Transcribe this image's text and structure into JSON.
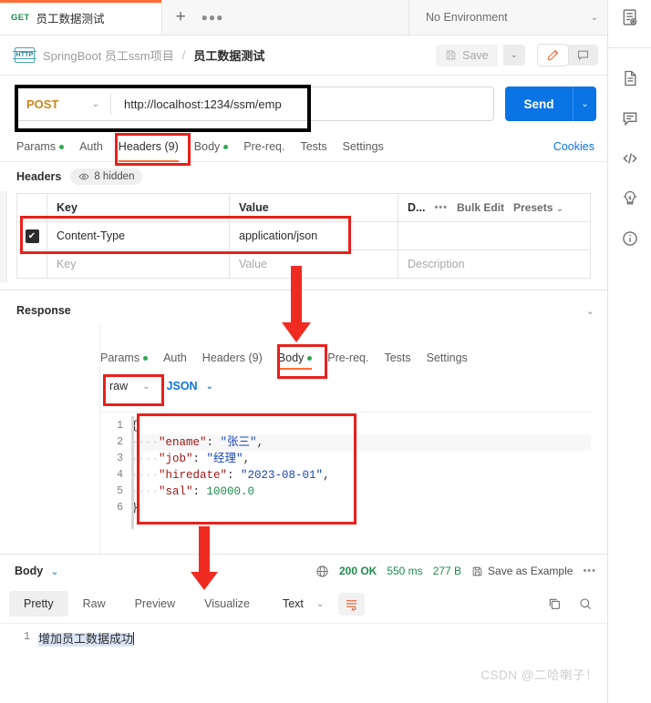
{
  "tab": {
    "method": "GET",
    "title": "员工数据测试",
    "plus_label": "+",
    "more_label": "●●●"
  },
  "environment": {
    "name": "No Environment",
    "chevron": "⌄",
    "eye_icon": "environment-quick-look-icon"
  },
  "breadcrumb": {
    "protocol_badge": "HTTP",
    "collection": "SpringBoot 员工ssm项目",
    "separator": "/",
    "request": "员工数据测试",
    "save_label": "Save",
    "save_caret": "⌄",
    "edit_icon": "pencil-icon",
    "comment_icon": "comment-icon"
  },
  "url": {
    "method": "POST",
    "method_chevron": "⌄",
    "value": "http://localhost:1234/ssm/emp",
    "send_label": "Send",
    "send_caret": "⌄"
  },
  "request_tabs": [
    {
      "label": "Params",
      "dot": true,
      "active": false
    },
    {
      "label": "Auth",
      "dot": false,
      "active": false
    },
    {
      "label": "Headers (9)",
      "dot": false,
      "active": true
    },
    {
      "label": "Body",
      "dot": true,
      "active": false
    },
    {
      "label": "Pre-req.",
      "dot": false,
      "active": false
    },
    {
      "label": "Tests",
      "dot": false,
      "active": false
    },
    {
      "label": "Settings",
      "dot": false,
      "active": false
    }
  ],
  "cookies_link": "Cookies",
  "headers": {
    "title": "Headers",
    "hidden_badge": "8 hidden",
    "eye_icon": "eye-icon",
    "columns": {
      "key": "Key",
      "value": "Value",
      "description": "D..."
    },
    "toolbar": {
      "more": "•••",
      "bulk_edit": "Bulk Edit",
      "presets": "Presets",
      "presets_chevron": "⌄"
    },
    "rows": [
      {
        "checked": true,
        "key": "Content-Type",
        "value": "application/json",
        "description": ""
      }
    ],
    "placeholder_row": {
      "key": "Key",
      "value": "Value",
      "description": "Description"
    }
  },
  "response_section": {
    "title": "Response",
    "collapse_chevron": "⌄"
  },
  "body_tabs": [
    {
      "label": "Params",
      "dot": true,
      "active": false
    },
    {
      "label": "Auth",
      "dot": false,
      "active": false
    },
    {
      "label": "Headers (9)",
      "dot": false,
      "active": false
    },
    {
      "label": "Body",
      "dot": true,
      "active": true
    },
    {
      "label": "Pre-req.",
      "dot": false,
      "active": false
    },
    {
      "label": "Tests",
      "dot": false,
      "active": false
    },
    {
      "label": "Settings",
      "dot": false,
      "active": false
    }
  ],
  "body_options": {
    "mode": "raw",
    "mode_chevron": "⌄",
    "format": "JSON",
    "format_chevron": "⌄"
  },
  "request_body": {
    "language": "json",
    "line_numbers": [
      "1",
      "2",
      "3",
      "4",
      "5",
      "6"
    ],
    "lines": [
      {
        "n": 1,
        "text": "{"
      },
      {
        "n": 2,
        "key": "\"ename\"",
        "value": "\"张三\"",
        "comma": ","
      },
      {
        "n": 3,
        "key": "\"job\"",
        "value": "\"经理\"",
        "comma": ","
      },
      {
        "n": 4,
        "key": "\"hiredate\"",
        "value": "\"2023-08-01\"",
        "comma": ","
      },
      {
        "n": 5,
        "key": "\"sal\"",
        "value": "10000.0",
        "comma": ""
      },
      {
        "n": 6,
        "text": "}"
      }
    ],
    "raw_text": "{\n    \"ename\": \"张三\",\n    \"job\": \"经理\",\n    \"hiredate\": \"2023-08-01\",\n    \"sal\": 10000.0\n}"
  },
  "response": {
    "body_label": "Body",
    "body_chevron": "⌄",
    "globe_icon": "globe-icon",
    "status": "200 OK",
    "time": "550 ms",
    "size": "277 B",
    "save_example": "Save as Example",
    "more": "•••",
    "view_tabs": [
      {
        "label": "Pretty",
        "active": true
      },
      {
        "label": "Raw",
        "active": false
      },
      {
        "label": "Preview",
        "active": false
      },
      {
        "label": "Visualize",
        "active": false
      }
    ],
    "format": "Text",
    "format_chevron": "⌄",
    "wrap_icon": "word-wrap-icon",
    "copy_icon": "copy-icon",
    "search_icon": "search-icon",
    "line_number": "1",
    "body_text": "增加员工数据成功"
  },
  "right_rail": [
    {
      "icon": "environment-quick-look-icon"
    },
    {
      "icon": "documentation-icon"
    },
    {
      "icon": "comments-icon"
    },
    {
      "icon": "code-snippet-icon"
    },
    {
      "icon": "bolt-idea-icon"
    },
    {
      "icon": "info-circle-icon"
    }
  ],
  "annotations": {
    "box_url_color": "#000000",
    "box_highlight_color": "#e8201b",
    "arrow_color": "#ef2b22"
  },
  "watermark": "CSDN @二哈喇子！"
}
